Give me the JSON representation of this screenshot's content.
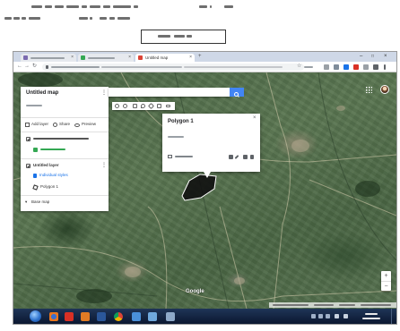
{
  "browser": {
    "active_tab_label": "Untitled map",
    "tab_close": "×",
    "new_tab": "+",
    "window_controls": {
      "minimize": "–",
      "maximize": "□",
      "close": "×"
    },
    "nav": {
      "back": "←",
      "forward": "→",
      "reload": "↻"
    },
    "bookmark_star": "☆"
  },
  "map_panel": {
    "title": "Untitled map",
    "kebab": "⋮",
    "actions": {
      "add_layer": "Add layer",
      "share": "Share",
      "preview": "Preview"
    },
    "layer": {
      "name": "Untitled layer",
      "style_link": "Individual styles",
      "feature": "Polygon 1"
    },
    "base_map": "Base map",
    "expand": "▾"
  },
  "popup": {
    "title": "Polygon 1",
    "close": "×"
  },
  "map": {
    "logo": "Google",
    "zoom_in": "+",
    "zoom_out": "−"
  },
  "taskbar": {
    "apps": [
      "windows-start-icon",
      "firefox-icon",
      "pdf-reader-icon",
      "media-player-icon",
      "word-icon",
      "chrome-icon",
      "folder-icon",
      "app-icon",
      "app-icon"
    ]
  },
  "colors": {
    "search_button": "#4285f4",
    "link": "#1a73e8",
    "my_maps_favicon": "#db4437",
    "polygon_fill": "#111111",
    "taskbar": "#14243f"
  }
}
